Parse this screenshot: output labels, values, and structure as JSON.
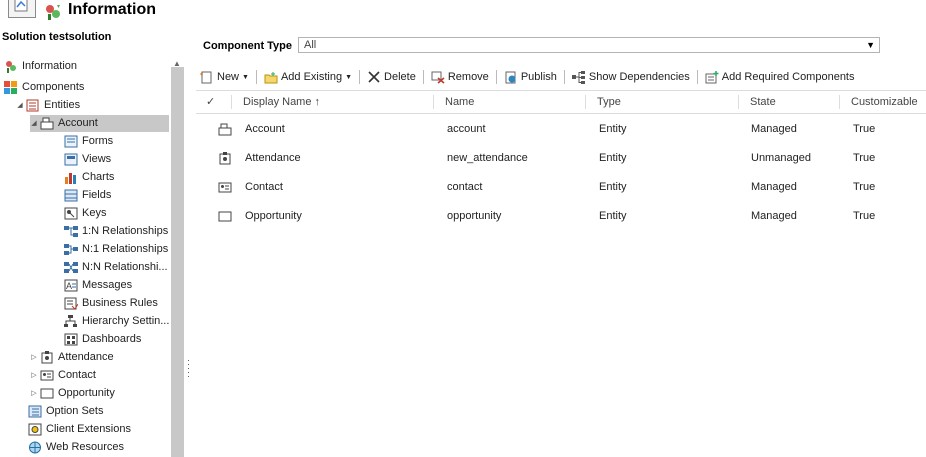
{
  "header": {
    "title": "Information"
  },
  "sidebar": {
    "solution_title": "Solution testsolution",
    "items": [
      {
        "label": "Information",
        "icon": "information-icon"
      },
      {
        "label": "Components",
        "icon": "components-icon"
      },
      {
        "label": "Entities",
        "icon": "entities-icon"
      },
      {
        "label": "Account",
        "icon": "account-entity-icon"
      },
      {
        "label": "Forms",
        "icon": "forms-icon"
      },
      {
        "label": "Views",
        "icon": "views-icon"
      },
      {
        "label": "Charts",
        "icon": "charts-icon"
      },
      {
        "label": "Fields",
        "icon": "fields-icon"
      },
      {
        "label": "Keys",
        "icon": "keys-icon"
      },
      {
        "label": "1:N Relationships",
        "icon": "relationship-icon"
      },
      {
        "label": "N:1 Relationships",
        "icon": "relationship-icon"
      },
      {
        "label": "N:N Relationshi...",
        "icon": "relationship-icon"
      },
      {
        "label": "Messages",
        "icon": "messages-icon"
      },
      {
        "label": "Business Rules",
        "icon": "business-rules-icon"
      },
      {
        "label": "Hierarchy Settin...",
        "icon": "hierarchy-icon"
      },
      {
        "label": "Dashboards",
        "icon": "dashboards-icon"
      },
      {
        "label": "Attendance",
        "icon": "attendance-entity-icon"
      },
      {
        "label": "Contact",
        "icon": "contact-entity-icon"
      },
      {
        "label": "Opportunity",
        "icon": "opportunity-entity-icon"
      },
      {
        "label": "Option Sets",
        "icon": "option-sets-icon"
      },
      {
        "label": "Client Extensions",
        "icon": "client-extensions-icon"
      },
      {
        "label": "Web Resources",
        "icon": "web-resources-icon"
      }
    ]
  },
  "main": {
    "component_type_label": "Component Type",
    "component_type_value": "All",
    "toolbar": {
      "new": "New",
      "add_existing": "Add Existing",
      "delete": "Delete",
      "remove": "Remove",
      "publish": "Publish",
      "show_dependencies": "Show Dependencies",
      "add_required": "Add Required Components"
    },
    "columns": {
      "display_name": "Display Name ↑",
      "name": "Name",
      "type": "Type",
      "state": "State",
      "customizable": "Customizable"
    },
    "rows": [
      {
        "display_name": "Account",
        "name": "account",
        "type": "Entity",
        "state": "Managed",
        "customizable": "True",
        "icon": "account-entity-icon"
      },
      {
        "display_name": "Attendance",
        "name": "new_attendance",
        "type": "Entity",
        "state": "Unmanaged",
        "customizable": "True",
        "icon": "attendance-entity-icon"
      },
      {
        "display_name": "Contact",
        "name": "contact",
        "type": "Entity",
        "state": "Managed",
        "customizable": "True",
        "icon": "contact-entity-icon"
      },
      {
        "display_name": "Opportunity",
        "name": "opportunity",
        "type": "Entity",
        "state": "Managed",
        "customizable": "True",
        "icon": "opportunity-entity-icon"
      }
    ]
  }
}
